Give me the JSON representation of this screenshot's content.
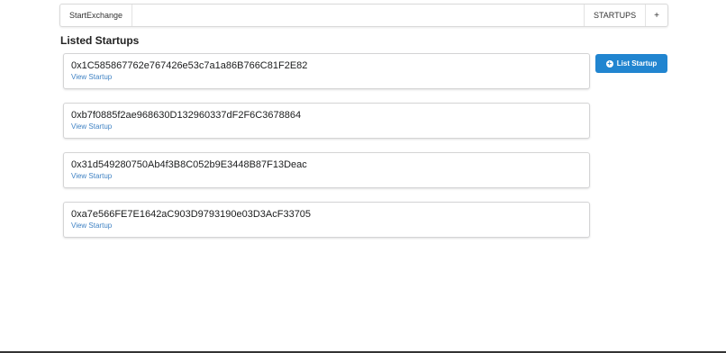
{
  "menu": {
    "brand": "StartExchange",
    "startups": "STARTUPS",
    "plus": "+"
  },
  "section_title": "Listed Startups",
  "list_button": {
    "icon": "plus-circle-icon",
    "label": "List Startup"
  },
  "startups": [
    {
      "address": "0x1C585867762e767426e53c7a1a86B766C81F2E82",
      "link": "View Startup"
    },
    {
      "address": "0xb7f0885f2ae968630D132960337dF2F6C3678864",
      "link": "View Startup"
    },
    {
      "address": "0x31d549280750Ab4f3B8C052b9E3448B87F13Deac",
      "link": "View Startup"
    },
    {
      "address": "0xa7e566FE7E1642aC903D9793190e03D3AcF33705",
      "link": "View Startup"
    }
  ],
  "colors": {
    "primary": "#2185d0",
    "link": "#4183c4"
  }
}
